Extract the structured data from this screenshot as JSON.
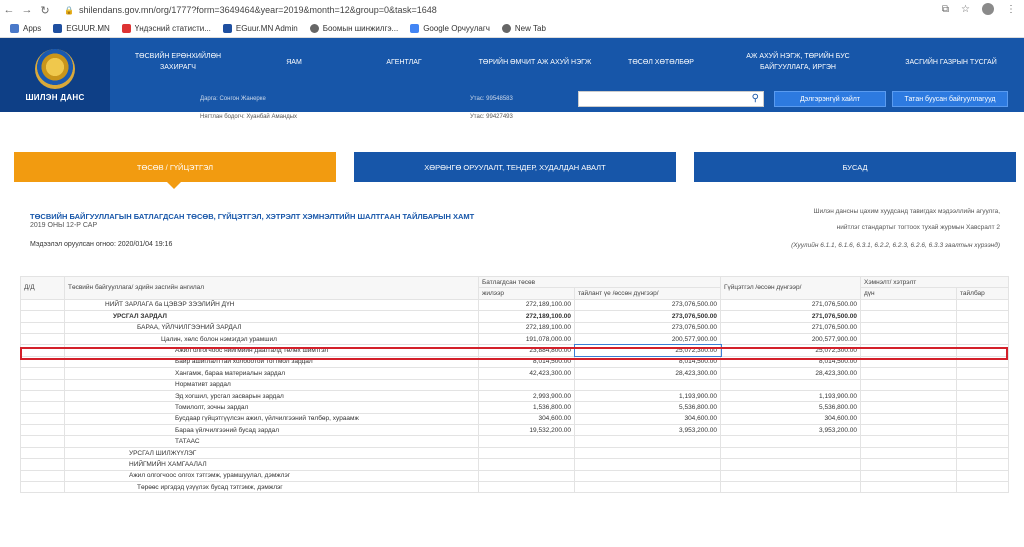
{
  "browser": {
    "url": "shilendans.gov.mn/org/1777?form=3649464&year=2019&month=12&group=0&task=1648",
    "bookmarks": [
      "Apps",
      "EGUUR.MN",
      "Үндэсний статисти...",
      "EGuur.MN Admin",
      "Боомын шинжилгэ...",
      "Google Орчуулагч",
      "New Tab"
    ]
  },
  "header": {
    "logo_text": "ШИЛЭН ДАНС",
    "nav": [
      "ТӨСВИЙН ЕРӨНХИЙЛӨН ЗАХИРАГЧ",
      "ЯАМ",
      "АГЕНТЛАГ",
      "ТӨРИЙН ӨМЧИТ АЖ АХУЙ НЭГЖ",
      "ТӨСӨЛ ХӨТӨЛБӨР",
      "АЖ АХУЙ НЭГЖ, ТӨРИЙН БУС БАЙГУУЛЛАГА, ИРГЭН",
      "ЗАСГИЙН ГАЗРЫН ТУСГАЙ"
    ],
    "search_placeholder": "",
    "advanced_search": "Дэлгэрэнгүй хайлт",
    "register_btn": "Татан буусан байгууллагууд"
  },
  "info_band": {
    "line1": "Дарга: Сонгон Жанерке",
    "line2": "Нягтлан бодогч: Хуанбай Амандых",
    "phone1": "Утас: 99548583",
    "phone2": "Утас: 99427493"
  },
  "tabs": {
    "t1": "ТӨСӨВ / ГҮЙЦЭТГЭЛ",
    "t2": "ХӨРӨНГӨ ОРУУЛАЛТ, ТЕНДЕР, ХУДАЛДАН АВАЛТ",
    "t3": "БУСАД"
  },
  "report": {
    "title": "ТӨСВИЙН БАЙГУУЛЛАГЫН БАТЛАГДСАН ТӨСӨВ, ГҮЙЦЭТГЭЛ, ХЭТРЭЛТ ХЭМНЭЛТИЙН ШАЛТГААН ТАЙЛБАРЫН ХАМТ",
    "subtitle": "2019 ОНЫ 12-Р САР",
    "posted": "Мэдээлэл оруулсан огноо: 2020/01/04 19:16",
    "note1": "Шилэн дансны цахим хуудсанд тавигдах мэдээллийн агуулга,",
    "note2": "нийтлэг стандартыг тогтоох тухай журмын Хавсралт 2",
    "law": "(Хуулийн 6.1.1, 6.1.6, 6.3.1, 6.2.2, 6.2.3, 6.2.6, 6.3.3 заалтын хүрээнд)"
  },
  "table": {
    "head": {
      "num": "Д/Д",
      "name": "Төсвийн байгууллага/ эдийн засгийн ангилал",
      "budget": "Батлагдсан төсөв",
      "actual": "Гүйцэтгэл /өссөн дүнгээр/",
      "savings": "Хэмнэлт/ хэтрэлт",
      "plan": "жилээр",
      "period": "тайлант үе /өссөн дүнгээр/",
      "amount": "дүн",
      "explain": "тайлбар"
    },
    "rows": [
      {
        "name": "НИЙТ ЗАРЛАГА ба ЦЭВЭР ЗЭЭЛИЙН ДҮН",
        "plan": "272,189,100.00",
        "period": "273,076,500.00",
        "actual": "271,076,500.00"
      },
      {
        "name": "УРСГАЛ ЗАРДАЛ",
        "plan": "272,189,100.00",
        "period": "273,076,500.00",
        "actual": "271,076,500.00"
      },
      {
        "name": "БАРАА, ҮЙЛЧИЛГЭЭНИЙ ЗАРДАЛ",
        "plan": "272,189,100.00",
        "period": "273,076,500.00",
        "actual": "271,076,500.00"
      },
      {
        "name": "Цалин, хөлс болон нэмэгдэл урамшил",
        "plan": "191,078,000.00",
        "period": "200,577,900.00",
        "actual": "200,577,900.00"
      },
      {
        "name": "Ажил олгогчоос нийгмийн даатгалд төлөх шимтгэл",
        "plan": "23,884,800.00",
        "period": "25,072,300.00",
        "actual": "25,072,300.00"
      },
      {
        "name": "Байр ашиглалттай холбоотой тогтмол зардал",
        "plan": "8,014,500.00",
        "period": "8,014,500.00",
        "actual": "8,014,500.00"
      },
      {
        "name": "Хангамж, бараа материалын зардал",
        "plan": "42,423,300.00",
        "period": "28,423,300.00",
        "actual": "28,423,300.00"
      },
      {
        "name": "Нормативт зардал",
        "plan": "",
        "period": "",
        "actual": ""
      },
      {
        "name": "Эд хогшил, урсгал засварын зардал",
        "plan": "2,993,900.00",
        "period": "1,193,900.00",
        "actual": "1,193,900.00"
      },
      {
        "name": "Томилолт, зочны зардал",
        "plan": "1,536,800.00",
        "period": "5,536,800.00",
        "actual": "5,536,800.00"
      },
      {
        "name": "Бусдаар гүйцэтгүүлсэн ажил, үйлчилгээний төлбөр, хураамж",
        "plan": "304,600.00",
        "period": "304,600.00",
        "actual": "304,600.00"
      },
      {
        "name": "Бараа үйлчилгээний бусад зардал",
        "plan": "19,532,200.00",
        "period": "3,953,200.00",
        "actual": "3,953,200.00"
      },
      {
        "name": "ТАТААС",
        "plan": "",
        "period": "",
        "actual": ""
      },
      {
        "name": "УРСГАЛ ШИЛЖҮҮЛЭГ",
        "plan": "",
        "period": "",
        "actual": ""
      },
      {
        "name": "НИЙГМИЙН ХАМГААЛАЛ",
        "plan": "",
        "period": "",
        "actual": ""
      },
      {
        "name": "Ажил олгогчоос олгох тэтгэмж, урамшуулал, дэмжлэг",
        "plan": "",
        "period": "",
        "actual": ""
      },
      {
        "name": "Төрөөс иргэдэд үзүүлэх бусад тэтгэмж, дэмжлэг",
        "plan": "",
        "period": "",
        "actual": ""
      }
    ]
  }
}
